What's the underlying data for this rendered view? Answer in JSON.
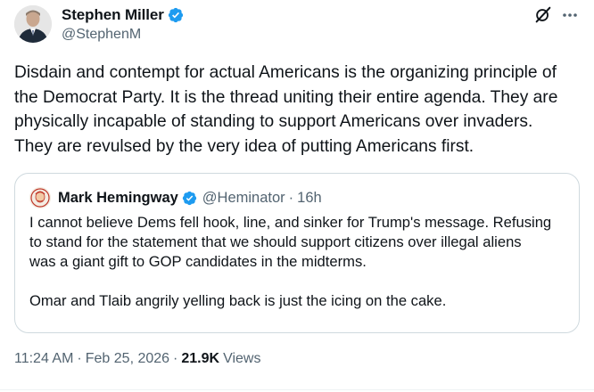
{
  "author": {
    "name": "Stephen Miller",
    "handle": "@StephenM"
  },
  "body_lines": [
    "Disdain and contempt for actual Americans is the organizing principle of",
    "the Democrat Party. It is the thread uniting their entire agenda. They are",
    "physically incapable of standing to support Americans over invaders.",
    "They are revulsed by the very idea of putting Americans first."
  ],
  "quoted_tweet": {
    "name": "Mark Hemingway",
    "handle": "@Heminator",
    "separator": "·",
    "time": "16h",
    "paragraph1_lines": [
      "I cannot believe Dems fell hook, line, and sinker for Trump's message. Refusing",
      "to stand for the statement that we should support citizens over illegal aliens",
      "was a giant gift to GOP candidates in the midterms."
    ],
    "paragraph2_lines": [
      "Omar and Tlaib angrily yelling back is just the icing on the cake."
    ]
  },
  "meta": {
    "time": "11:24 AM",
    "separator": "·",
    "date": "Feb 25, 2026",
    "views_count": "21.9K",
    "views_label": "Views"
  },
  "icons": {
    "verified": "verified-badge-icon",
    "grok": "grok-icon",
    "more": "more-icon"
  },
  "colors": {
    "text_primary": "#0f1419",
    "text_secondary": "#536471",
    "verified_blue": "#1d9bf0",
    "border": "#cfd9de"
  }
}
